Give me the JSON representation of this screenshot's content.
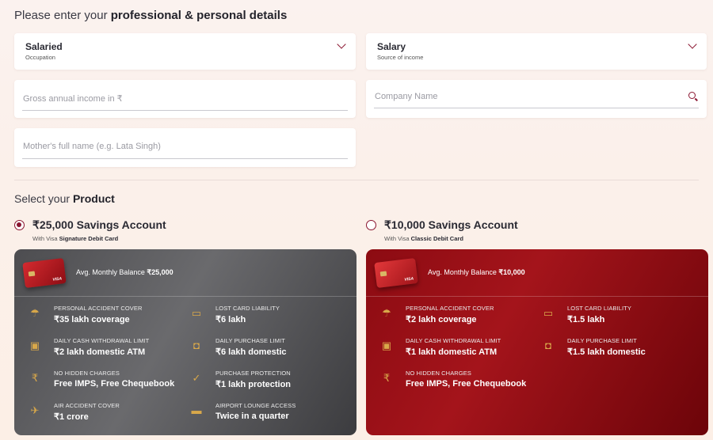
{
  "heading": {
    "prefix": "Please enter your ",
    "bold": "professional & personal details"
  },
  "occupation": {
    "value": "Salaried",
    "label": "Occupation"
  },
  "income_source": {
    "value": "Salary",
    "label": "Source of income"
  },
  "gross_income": {
    "placeholder": "Gross annual income in ₹"
  },
  "company": {
    "placeholder": "Company Name"
  },
  "mother_name": {
    "placeholder": "Mother's full name (e.g. Lata Singh)"
  },
  "product_heading": {
    "prefix": "Select your ",
    "bold": "Product"
  },
  "products": [
    {
      "title": "₹25,000 Savings Account",
      "sub_prefix": "With Visa ",
      "sub_bold": "Signature Debit Card",
      "selected": true,
      "balance_label": "Avg. Monthly Balance ",
      "balance_value": "₹25,000",
      "features": [
        {
          "icon": "umbrella-icon",
          "label": "PERSONAL ACCIDENT COVER",
          "value": "₹35 lakh coverage"
        },
        {
          "icon": "card-icon",
          "label": "LOST CARD LIABILITY",
          "value": "₹6 lakh"
        },
        {
          "icon": "cash-icon",
          "label": "DAILY CASH WITHDRAWAL LIMIT",
          "value": "₹2 lakh domestic ATM"
        },
        {
          "icon": "shopping-bag-icon",
          "label": "DAILY PURCHASE LIMIT",
          "value": "₹6 lakh domestic"
        },
        {
          "icon": "rupee-icon",
          "label": "NO HIDDEN CHARGES",
          "value": "Free IMPS, Free Chequebook"
        },
        {
          "icon": "shield-check-icon",
          "label": "PURCHASE PROTECTION",
          "value": "₹1 lakh protection"
        },
        {
          "icon": "airplane-icon",
          "label": "AIR ACCIDENT COVER",
          "value": "₹1 crore"
        },
        {
          "icon": "lounge-icon",
          "label": "AIRPORT LOUNGE ACCESS",
          "value": "Twice in a quarter"
        }
      ]
    },
    {
      "title": "₹10,000 Savings Account",
      "sub_prefix": "With Visa ",
      "sub_bold": "Classic Debit Card",
      "selected": false,
      "balance_label": "Avg. Monthly Balance ",
      "balance_value": "₹10,000",
      "features": [
        {
          "icon": "umbrella-icon",
          "label": "PERSONAL ACCIDENT COVER",
          "value": "₹2 lakh coverage"
        },
        {
          "icon": "card-icon",
          "label": "LOST CARD LIABILITY",
          "value": "₹1.5 lakh"
        },
        {
          "icon": "cash-icon",
          "label": "DAILY CASH WITHDRAWAL LIMIT",
          "value": "₹1 lakh domestic ATM"
        },
        {
          "icon": "shopping-bag-icon",
          "label": "DAILY PURCHASE LIMIT",
          "value": "₹1.5 lakh domestic"
        },
        {
          "icon": "rupee-icon",
          "label": "NO HIDDEN CHARGES",
          "value": "Free IMPS, Free Chequebook"
        }
      ]
    }
  ],
  "card_brand": "VISA",
  "colors": {
    "accent": "#8a1530",
    "gold_icon": "#d9a84a",
    "card_grey": "#4d4d50",
    "card_red": "#8c0b12"
  }
}
